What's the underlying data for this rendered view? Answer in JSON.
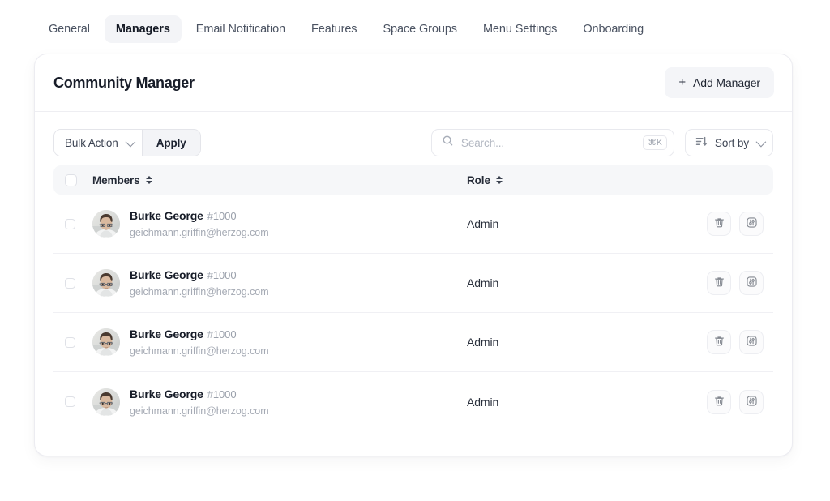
{
  "tabs": [
    {
      "label": "General",
      "active": false
    },
    {
      "label": "Managers",
      "active": true
    },
    {
      "label": "Email Notification",
      "active": false
    },
    {
      "label": "Features",
      "active": false
    },
    {
      "label": "Space Groups",
      "active": false
    },
    {
      "label": "Menu Settings",
      "active": false
    },
    {
      "label": "Onboarding",
      "active": false
    }
  ],
  "card": {
    "title": "Community Manager",
    "add_button": {
      "label": "Add Manager",
      "icon": "plus-icon"
    }
  },
  "toolbar": {
    "bulk_action": {
      "label": "Bulk Action",
      "icon": "chevron-down-icon"
    },
    "apply_label": "Apply",
    "search": {
      "placeholder": "Search...",
      "value": "",
      "icon": "search-icon",
      "shortcut": "⌘K"
    },
    "sort_by": {
      "label": "Sort by",
      "icon": "sort-descending-icon",
      "chevron": "chevron-down-icon"
    }
  },
  "table": {
    "columns": {
      "members": "Members",
      "role": "Role"
    },
    "select_all_checked": false,
    "rows": [
      {
        "checked": false,
        "name": "Burke George",
        "id": "#1000",
        "email": "geichmann.griffin@herzog.com",
        "role": "Admin",
        "avatar": "user-photo-avatar",
        "actions": [
          "trash-icon",
          "adjustments-icon"
        ]
      },
      {
        "checked": false,
        "name": "Burke George",
        "id": "#1000",
        "email": "geichmann.griffin@herzog.com",
        "role": "Admin",
        "avatar": "user-photo-avatar",
        "actions": [
          "trash-icon",
          "adjustments-icon"
        ]
      },
      {
        "checked": false,
        "name": "Burke George",
        "id": "#1000",
        "email": "geichmann.griffin@herzog.com",
        "role": "Admin",
        "avatar": "user-photo-avatar",
        "actions": [
          "trash-icon",
          "adjustments-icon"
        ]
      },
      {
        "checked": false,
        "name": "Burke George",
        "id": "#1000",
        "email": "geichmann.griffin@herzog.com",
        "role": "Admin",
        "avatar": "user-photo-avatar",
        "actions": [
          "trash-icon",
          "adjustments-icon"
        ]
      }
    ]
  },
  "colors": {
    "page_bg": "#ffffff",
    "card_border": "#ececf1",
    "header_row_bg": "#f6f7f9",
    "active_tab_bg": "#f3f4f7",
    "muted_text": "#9aa0ab",
    "primary_text": "#171c28"
  }
}
